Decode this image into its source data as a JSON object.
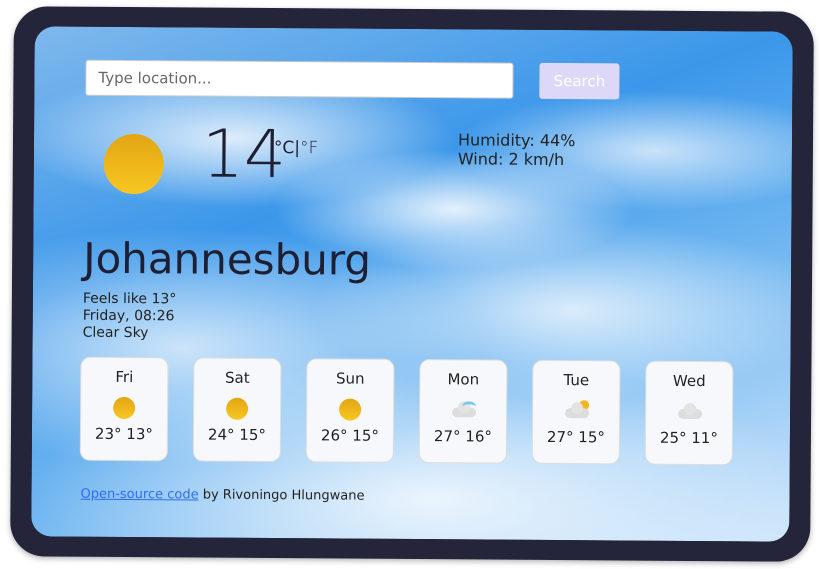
{
  "search": {
    "placeholder": "Type location...",
    "button_label": "Search"
  },
  "current": {
    "icon": "clear-sky-sun-icon",
    "temperature": "14",
    "unit_c": "°C",
    "separator": "|",
    "unit_f": "°F",
    "humidity": "Humidity: 44%",
    "wind": "Wind: 2 km/h",
    "city": "Johannesburg",
    "feels_like": "Feels like 13°",
    "datetime": "Friday, 08:26",
    "description": "Clear Sky"
  },
  "forecast": [
    {
      "day": "Fri",
      "icon": "sun-icon",
      "range": "23° 13°"
    },
    {
      "day": "Sat",
      "icon": "sun-icon",
      "range": "24° 15°"
    },
    {
      "day": "Sun",
      "icon": "sun-icon",
      "range": "26° 15°"
    },
    {
      "day": "Mon",
      "icon": "cloud-rain-icon",
      "range": "27° 16°"
    },
    {
      "day": "Tue",
      "icon": "partly-cloudy-icon",
      "range": "27° 15°"
    },
    {
      "day": "Wed",
      "icon": "cloud-icon",
      "range": "25° 11°"
    }
  ],
  "footer": {
    "link": "Open-source code",
    "credit": " by Rivoningo Hlungwane"
  },
  "colors": {
    "frame": "#24253a",
    "button": "#ddd7f8",
    "link": "#2f6df0",
    "sun": "#f8c722"
  }
}
